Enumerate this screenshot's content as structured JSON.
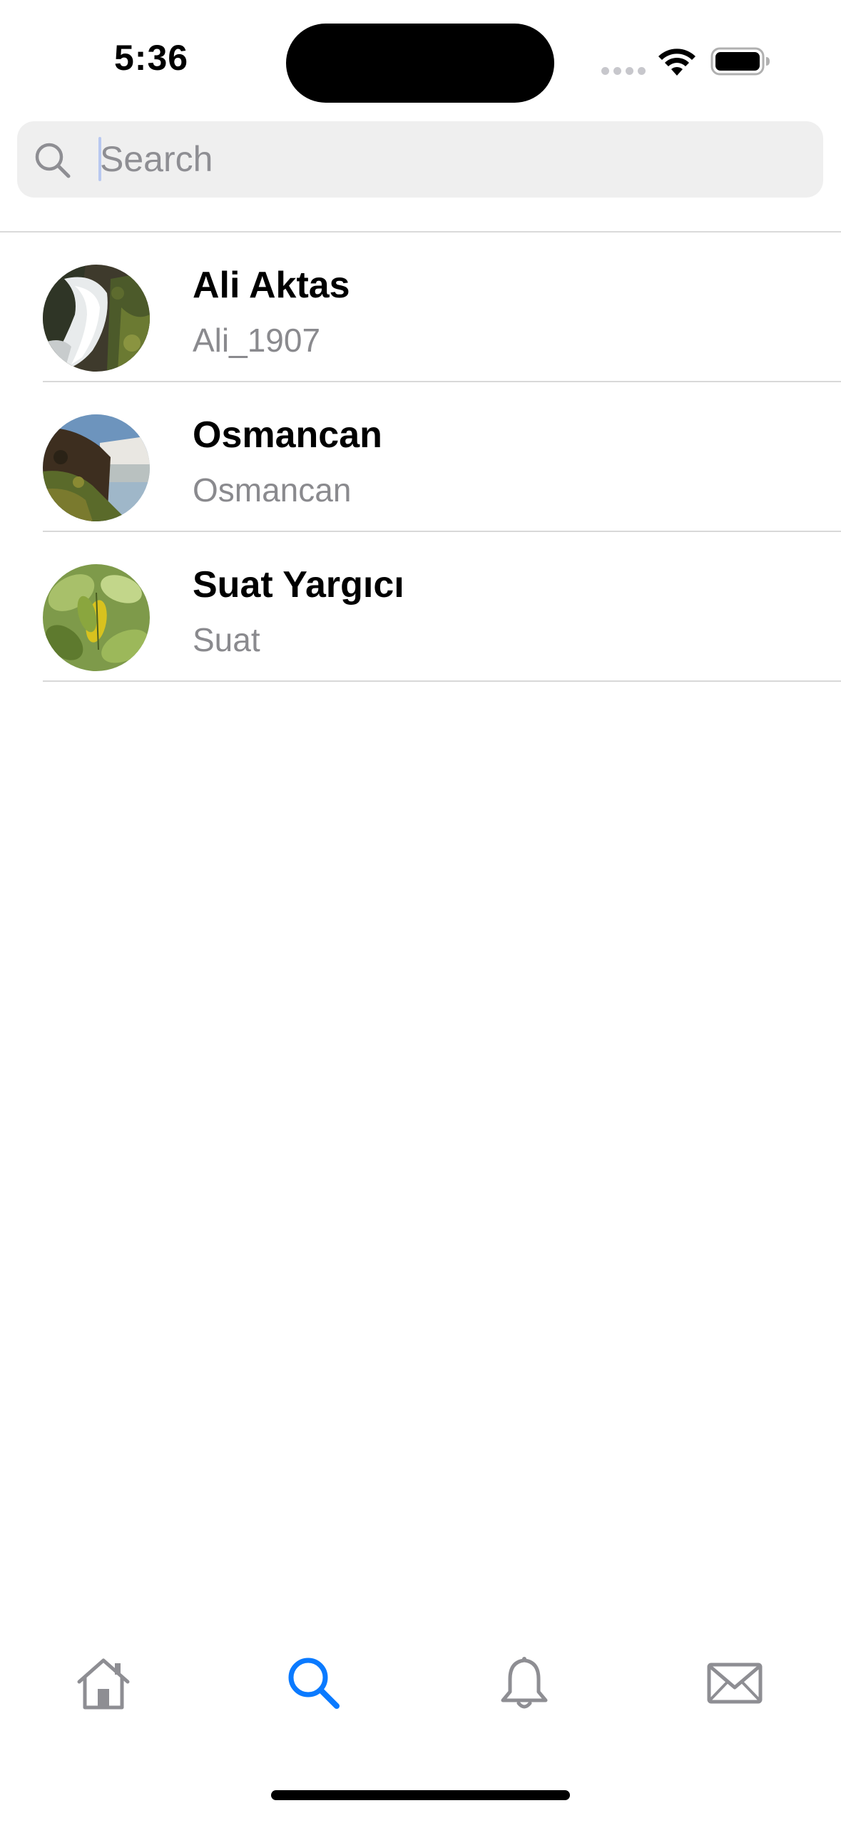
{
  "status_bar": {
    "time": "5:36"
  },
  "search": {
    "placeholder": "Search",
    "value": ""
  },
  "results": [
    {
      "name": "Ali Aktas",
      "username": "Ali_1907",
      "avatar": "waterfall-photo"
    },
    {
      "name": "Osmancan",
      "username": "Osmancan",
      "avatar": "waterfall-cliff-photo"
    },
    {
      "name": "Suat Yargıcı",
      "username": "Suat",
      "avatar": "green-leaves-photo"
    }
  ],
  "tab_bar": {
    "tabs": [
      {
        "icon": "home-icon",
        "active": false
      },
      {
        "icon": "search-icon",
        "active": true
      },
      {
        "icon": "bell-icon",
        "active": false
      },
      {
        "icon": "mail-icon",
        "active": false
      }
    ]
  },
  "colors": {
    "accent": "#0a7aff",
    "inactive_icon": "#8e8e93",
    "secondary_text": "#8a8a8e",
    "search_bg": "#efefef"
  }
}
